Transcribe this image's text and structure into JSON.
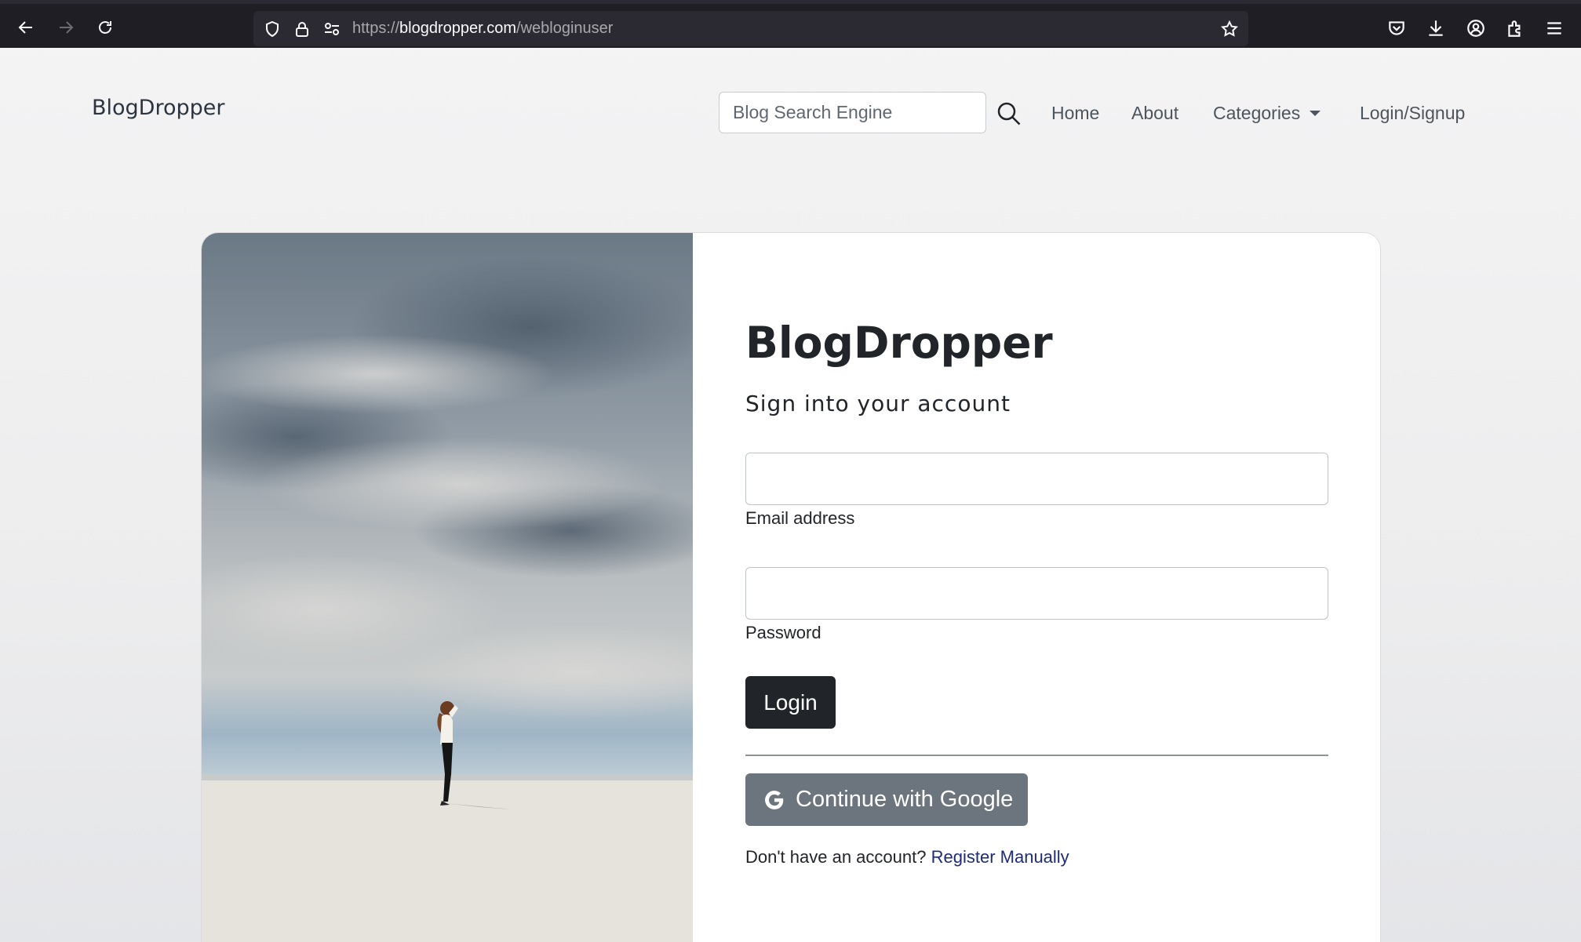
{
  "browser": {
    "url_scheme": "https://",
    "url_host": "blogdropper.com",
    "url_path": "/webloginuser"
  },
  "navbar": {
    "brand": "BlogDropper",
    "search_placeholder": "Blog Search Engine",
    "links": {
      "home": "Home",
      "about": "About",
      "categories": "Categories",
      "login_signup": "Login/Signup"
    }
  },
  "login_form": {
    "title": "BlogDropper",
    "subtitle": "Sign into your account",
    "email_label": "Email address",
    "email_value": "",
    "password_label": "Password",
    "password_value": "",
    "login_button": "Login",
    "google_button": "Continue with Google",
    "register_prompt": "Don't have an account?",
    "register_link": "Register Manually"
  },
  "colors": {
    "dark_button": "#212529",
    "google_button": "#6c757d",
    "register_link": "#1d2b7a"
  }
}
